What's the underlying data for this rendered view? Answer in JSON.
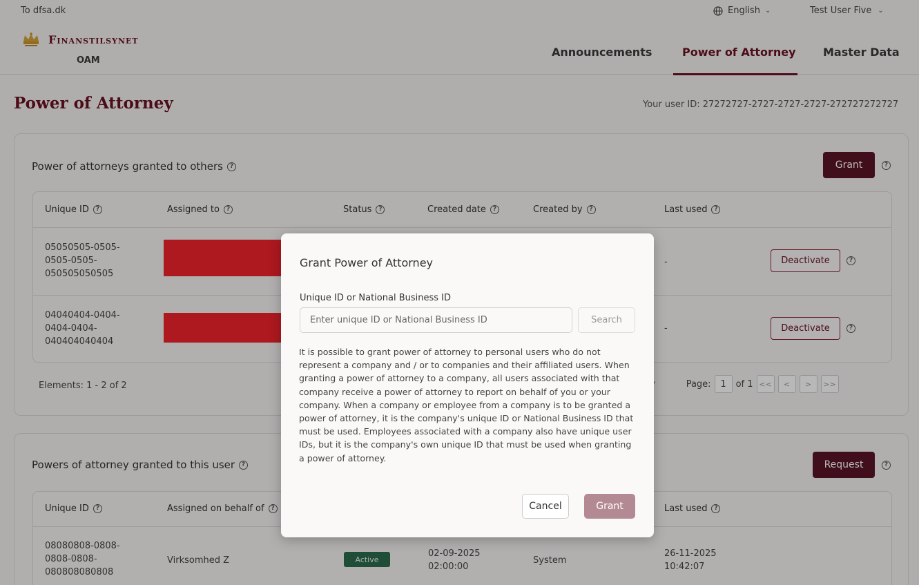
{
  "topbar": {
    "back_link": "To dfsa.dk",
    "language": "English",
    "user": "Test User Five"
  },
  "header": {
    "brand": "Finanstilsynet",
    "sub": "OAM",
    "nav": [
      "Announcements",
      "Power of Attorney",
      "Master Data"
    ],
    "active_nav": "Power of Attorney"
  },
  "page": {
    "title": "Power of Attorney",
    "user_id_text": "Your user ID: 27272727-2727-2727-2727-272727272727"
  },
  "granted_to_others": {
    "title": "Power of attorneys granted to others",
    "grant_button": "Grant",
    "columns": [
      "Unique ID",
      "Assigned to",
      "Status",
      "Created date",
      "Created by",
      "Last used"
    ],
    "rows": [
      {
        "id_line1": "05050505-0505-",
        "id_line2": "0505-0505-",
        "id_line3": "050505050505",
        "last_used": "-",
        "action": "Deactivate"
      },
      {
        "id_line1": "04040404-0404-",
        "id_line2": "0404-0404-",
        "id_line3": "040404040404",
        "last_used": "-",
        "action": "Deactivate"
      }
    ],
    "elements_text": "Elements: 1 - 2 of 2",
    "pager": {
      "page_label": "Page:",
      "page": "1",
      "of": "of 1",
      "first": "<<",
      "prev": "<",
      "next": ">",
      "last": ">>"
    }
  },
  "granted_to_user": {
    "title": "Powers of attorney granted to this user",
    "request_button": "Request",
    "columns": [
      "Unique ID",
      "Assigned on behalf of",
      "Last used"
    ],
    "rows": [
      {
        "id_line1": "08080808-0808-",
        "id_line2": "0808-0808-",
        "id_line3": "080808080808",
        "on_behalf": "Virksomhed Z",
        "status": "Active",
        "created_date": "02-09-2025",
        "created_time": "02:00:00",
        "created_by": "System",
        "last_used_date": "26-11-2025",
        "last_used_time": "10:42:07"
      }
    ]
  },
  "modal": {
    "title": "Grant Power of Attorney",
    "field_label": "Unique ID or National Business ID",
    "placeholder": "Enter unique ID or National Business ID",
    "search": "Search",
    "description": "It is possible to grant power of attorney to personal users who do not represent a company and / or to companies and their affiliated users. When granting a power of attorney to a company, all users associated with that company receive a power of attorney to report on behalf of you or your company. When a company or employee from a company is to be granted a power of attorney, it is the company's unique ID or National Business ID that must be used. Employees associated with a company also have unique user IDs, but it is the company's own unique ID that must be used when granting a power of attorney.",
    "cancel": "Cancel",
    "grant": "Grant"
  },
  "colors": {
    "brand": "#6a1122",
    "button_dark": "#5a1426",
    "status_active": "#2b6b4e",
    "redaction": "#f0232c"
  },
  "icons": {
    "language": "globe-icon",
    "help": "help-circle-icon",
    "chevron": "chevron-down-icon"
  }
}
